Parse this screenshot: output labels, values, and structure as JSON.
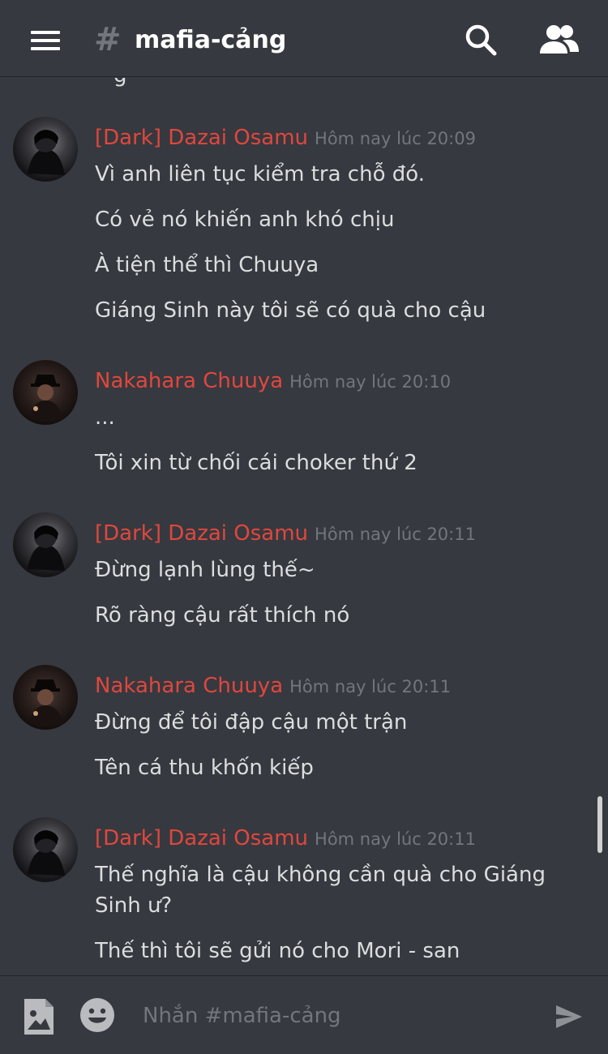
{
  "header": {
    "hash_symbol": "#",
    "channel_name": "mafia-cảng",
    "menu_icon": "hamburger-menu-icon",
    "search_icon": "search-icon",
    "members_icon": "members-icon"
  },
  "messages": {
    "partial_line": "g",
    "groups": [
      {
        "author": "[Dark] Dazai Osamu",
        "timestamp": "Hôm nay lúc 20:09",
        "lines": [
          "Vì anh liên tục kiểm tra chỗ đó.",
          "Có vẻ nó khiến anh khó chịu",
          "À tiện thể thì Chuuya",
          "Giáng Sinh này tôi sẽ có quà cho cậu"
        ]
      },
      {
        "author": "Nakahara Chuuya",
        "timestamp": "Hôm nay lúc 20:10",
        "lines": [
          "...",
          "Tôi xin từ chối cái choker thứ 2"
        ]
      },
      {
        "author": "[Dark] Dazai Osamu",
        "timestamp": "Hôm nay lúc 20:11",
        "lines": [
          "Đừng lạnh lùng thế~",
          "Rõ ràng cậu rất thích nó"
        ]
      },
      {
        "author": "Nakahara Chuuya",
        "timestamp": "Hôm nay lúc 20:11",
        "lines": [
          "Đừng để tôi đập cậu một trận",
          "Tên cá thu khốn kiếp"
        ]
      },
      {
        "author": "[Dark] Dazai Osamu",
        "timestamp": "Hôm nay lúc 20:11",
        "lines": [
          "Thế nghĩa là cậu không cần quà cho Giáng Sinh ư?",
          "Thế thì tôi sẽ gửi nó cho Mori - san"
        ]
      }
    ]
  },
  "composer": {
    "placeholder": "Nhắn #mafia-cảng",
    "value": "",
    "image_icon": "image-upload-icon",
    "emoji_icon": "emoji-icon",
    "send_icon": "send-icon"
  },
  "colors": {
    "background": "#36393f",
    "author_name": "#e0473e",
    "timestamp": "#72767d",
    "message_text": "#dcddde"
  }
}
